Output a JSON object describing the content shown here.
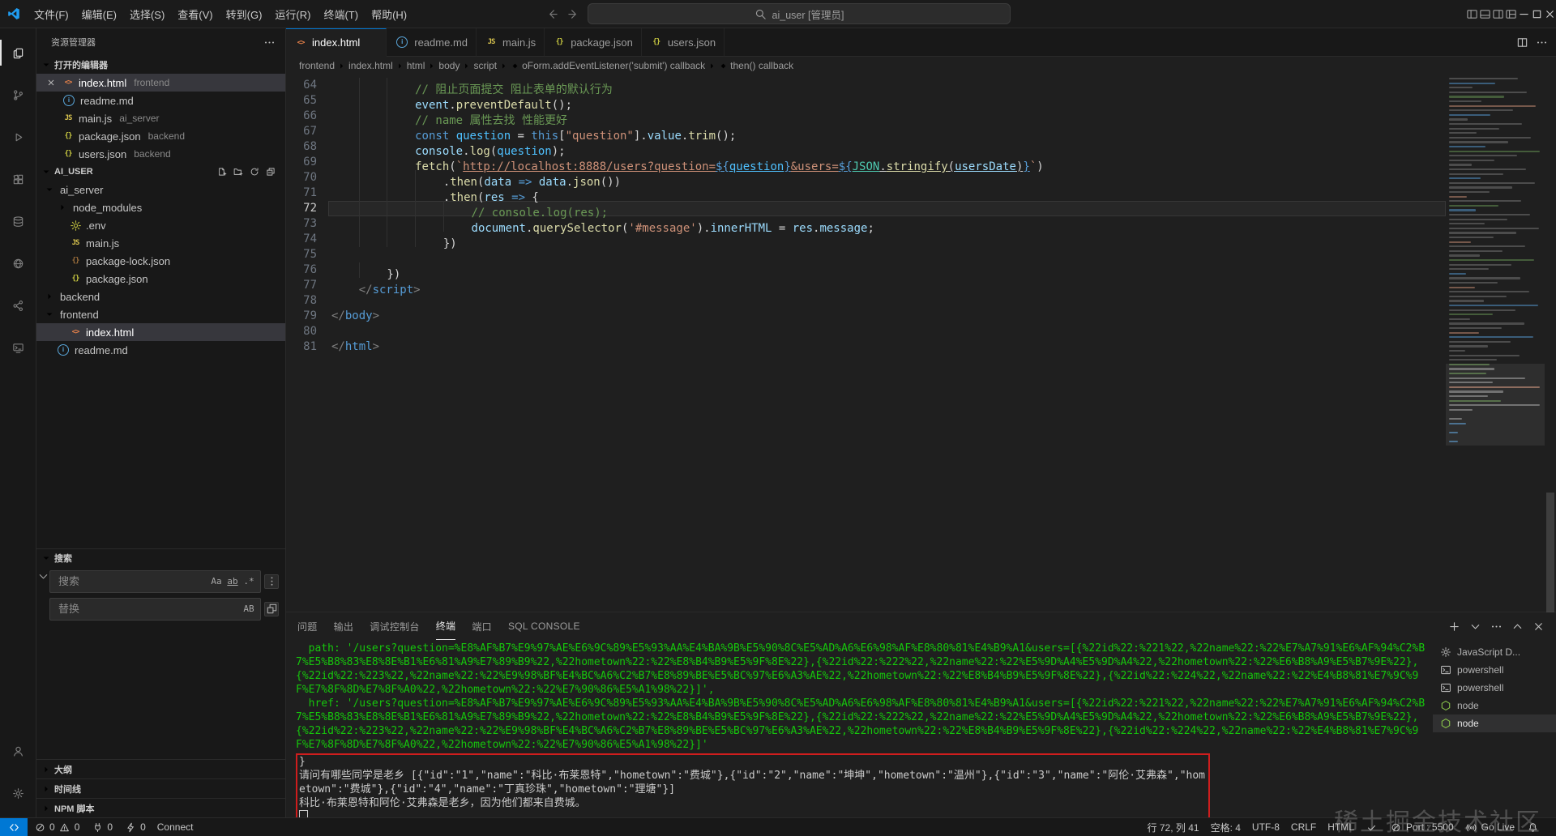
{
  "titlebar": {
    "menus": [
      "文件(F)",
      "编辑(E)",
      "选择(S)",
      "查看(V)",
      "转到(G)",
      "运行(R)",
      "终端(T)",
      "帮助(H)"
    ],
    "command_center": "ai_user [管理员]"
  },
  "activity_bar": {
    "top": [
      {
        "name": "explorer",
        "active": true
      },
      {
        "name": "source-control"
      },
      {
        "name": "run-and-debug"
      },
      {
        "name": "extensions"
      },
      {
        "name": "database"
      },
      {
        "name": "globe"
      },
      {
        "name": "live-share"
      },
      {
        "name": "remote-explorer"
      }
    ],
    "bottom": [
      {
        "name": "accounts"
      },
      {
        "name": "manage"
      }
    ]
  },
  "sidebar": {
    "title": "资源管理器",
    "open_editors": {
      "header": "打开的编辑器",
      "items": [
        {
          "icon": "html",
          "name": "index.html",
          "badge": "frontend",
          "selected": true,
          "close": true
        },
        {
          "icon": "info",
          "name": "readme.md",
          "badge": ""
        },
        {
          "icon": "js",
          "name": "main.js",
          "badge": "ai_server"
        },
        {
          "icon": "json",
          "name": "package.json",
          "badge": "backend"
        },
        {
          "icon": "json",
          "name": "users.json",
          "badge": "backend"
        }
      ]
    },
    "tree": {
      "header": "AI_USER",
      "items": [
        {
          "label": "ai_server",
          "folder": true,
          "expanded": true,
          "level": 0
        },
        {
          "label": "node_modules",
          "folder": true,
          "level": 1
        },
        {
          "label": ".env",
          "icon": "gear",
          "level": 1
        },
        {
          "label": "main.js",
          "icon": "js",
          "level": 1
        },
        {
          "label": "package-lock.json",
          "icon": "lock",
          "level": 1
        },
        {
          "label": "package.json",
          "icon": "json",
          "level": 1
        },
        {
          "label": "backend",
          "folder": true,
          "level": 0
        },
        {
          "label": "frontend",
          "folder": true,
          "expanded": true,
          "level": 0
        },
        {
          "label": "index.html",
          "icon": "html",
          "level": 1,
          "selected": true
        },
        {
          "label": "readme.md",
          "icon": "info",
          "level": 0
        }
      ]
    },
    "search": {
      "header": "搜索",
      "search_placeholder": "搜索",
      "replace_placeholder": "替换"
    },
    "bottom_sections": [
      "大纲",
      "时间线",
      "NPM 脚本"
    ]
  },
  "editor": {
    "tabs": [
      {
        "icon": "html",
        "label": "index.html",
        "active": true
      },
      {
        "icon": "info",
        "label": "readme.md"
      },
      {
        "icon": "js",
        "label": "main.js"
      },
      {
        "icon": "json",
        "label": "package.json"
      },
      {
        "icon": "json",
        "label": "users.json"
      }
    ],
    "breadcrumb": [
      {
        "label": "frontend"
      },
      {
        "label": "index.html"
      },
      {
        "label": "html"
      },
      {
        "label": "body"
      },
      {
        "label": "script"
      },
      {
        "label": "oForm.addEventListener('submit') callback",
        "sym": true
      },
      {
        "label": "then() callback",
        "sym": true
      }
    ],
    "code": {
      "current_line": 72,
      "lines": [
        {
          "n": 64,
          "i": 3,
          "tk": [
            [
              "c",
              "// 阻止页面提交 阻止表单的默认行为"
            ]
          ]
        },
        {
          "n": 65,
          "i": 3,
          "tk": [
            [
              "v",
              "event"
            ],
            [
              "p",
              "."
            ],
            [
              "f",
              "preventDefault"
            ],
            [
              "p",
              "();"
            ]
          ]
        },
        {
          "n": 66,
          "i": 3,
          "tk": [
            [
              "c",
              "// name 属性去找 性能更好"
            ]
          ]
        },
        {
          "n": 67,
          "i": 3,
          "tk": [
            [
              "k",
              "const "
            ],
            [
              "C",
              "question"
            ],
            [
              "p",
              " = "
            ],
            [
              "k",
              "this"
            ],
            [
              "p",
              "["
            ],
            [
              "s",
              "\"question\""
            ],
            [
              "p",
              "]."
            ],
            [
              "v",
              "value"
            ],
            [
              "p",
              "."
            ],
            [
              "f",
              "trim"
            ],
            [
              "p",
              "();"
            ]
          ]
        },
        {
          "n": 68,
          "i": 3,
          "tk": [
            [
              "v",
              "console"
            ],
            [
              "p",
              "."
            ],
            [
              "f",
              "log"
            ],
            [
              "p",
              "("
            ],
            [
              "C",
              "question"
            ],
            [
              "p",
              ");"
            ]
          ]
        },
        {
          "n": 69,
          "i": 3,
          "tk": [
            [
              "f",
              "fetch"
            ],
            [
              "p",
              "("
            ],
            [
              "s",
              "`"
            ],
            [
              "s",
              "http://localhost:8888/users?question=",
              1
            ],
            [
              "k",
              "${",
              1
            ],
            [
              "C",
              "question",
              1
            ],
            [
              "k",
              "}",
              1
            ],
            [
              "s",
              "&users=",
              1
            ],
            [
              "k",
              "${",
              1
            ],
            [
              "K",
              "JSON",
              1
            ],
            [
              "p",
              ".",
              1
            ],
            [
              "f",
              "stringify",
              1
            ],
            [
              "p",
              "(",
              1
            ],
            [
              "v",
              "usersDate",
              1
            ],
            [
              "p",
              ")",
              1
            ],
            [
              "k",
              "}",
              1
            ],
            [
              "s",
              "`"
            ],
            [
              "p",
              ")"
            ]
          ]
        },
        {
          "n": 70,
          "i": 4,
          "tk": [
            [
              "p",
              "."
            ],
            [
              "f",
              "then"
            ],
            [
              "p",
              "("
            ],
            [
              "v",
              "data"
            ],
            [
              "p",
              " "
            ],
            [
              "k",
              "=>"
            ],
            [
              "p",
              " "
            ],
            [
              "v",
              "data"
            ],
            [
              "p",
              "."
            ],
            [
              "f",
              "json"
            ],
            [
              "p",
              "())"
            ]
          ]
        },
        {
          "n": 71,
          "i": 4,
          "tk": [
            [
              "p",
              "."
            ],
            [
              "f",
              "then"
            ],
            [
              "p",
              "("
            ],
            [
              "v",
              "res"
            ],
            [
              "p",
              " "
            ],
            [
              "k",
              "=>"
            ],
            [
              "p",
              " {"
            ]
          ]
        },
        {
          "n": 72,
          "i": 5,
          "tk": [
            [
              "c",
              "// console.log(res);"
            ]
          ]
        },
        {
          "n": 73,
          "i": 5,
          "tk": [
            [
              "v",
              "document"
            ],
            [
              "p",
              "."
            ],
            [
              "f",
              "querySelector"
            ],
            [
              "p",
              "("
            ],
            [
              "s",
              "'#message'"
            ],
            [
              "p",
              ")."
            ],
            [
              "v",
              "innerHTML"
            ],
            [
              "p",
              " = "
            ],
            [
              "v",
              "res"
            ],
            [
              "p",
              "."
            ],
            [
              "v",
              "message"
            ],
            [
              "p",
              ";"
            ]
          ]
        },
        {
          "n": 74,
          "i": 4,
          "tk": [
            [
              "p",
              "})"
            ]
          ]
        },
        {
          "n": 75,
          "i": 0,
          "tk": []
        },
        {
          "n": 76,
          "i": 2,
          "tk": [
            [
              "p",
              "})"
            ]
          ]
        },
        {
          "n": 77,
          "i": 1,
          "tk": [
            [
              "t",
              "</"
            ],
            [
              "T",
              "script"
            ],
            [
              "t",
              ">"
            ]
          ]
        },
        {
          "n": 78,
          "i": 0,
          "tk": []
        },
        {
          "n": 79,
          "i": 0,
          "tk": [
            [
              "t",
              "</"
            ],
            [
              "T",
              "body"
            ],
            [
              "t",
              ">"
            ]
          ]
        },
        {
          "n": 80,
          "i": 0,
          "tk": []
        },
        {
          "n": 81,
          "i": 0,
          "tk": [
            [
              "t",
              "</"
            ],
            [
              "T",
              "html"
            ],
            [
              "t",
              ">"
            ]
          ]
        }
      ]
    }
  },
  "panel": {
    "tabs": [
      "问题",
      "输出",
      "调试控制台",
      "终端",
      "端口",
      "SQL CONSOLE"
    ],
    "active_tab": "终端",
    "terminal": {
      "green_lines": [
        "  path: '/users?question=%E8%AF%B7%E9%97%AE%E6%9C%89%E5%93%AA%E4%BA%9B%E5%90%8C%E5%AD%A6%E6%98%AF%E8%80%81%E4%B9%A1&users=[{%22id%22:%221%22,%22name%22:%22%E7%A7%91%E6%AF%94%C2%B7%E5%B8%83%E8%8E%B1%E6%81%A9%E7%89%B9%22,%22hometown%22:%22%E8%B4%B9%E5%9F%8E%22},{%22id%22:%222%22,%22name%22:%22%E5%9D%A4%E5%9D%A4%22,%22hometown%22:%22%E6%B8%A9%E5%B7%9E%22},{%22id%22:%223%22,%22name%22:%22%E9%98%BF%E4%BC%A6%C2%B7%E8%89%BE%E5%BC%97%E6%A3%AE%22,%22hometown%22:%22%E8%B4%B9%E5%9F%8E%22},{%22id%22:%224%22,%22name%22:%22%E4%B8%81%E7%9C%9F%E7%8F%8D%E7%8F%A0%22,%22hometown%22:%22%E7%90%86%E5%A1%98%22}]',",
        "  href: '/users?question=%E8%AF%B7%E9%97%AE%E6%9C%89%E5%93%AA%E4%BA%9B%E5%90%8C%E5%AD%A6%E6%98%AF%E8%80%81%E4%B9%A1&users=[{%22id%22:%221%22,%22name%22:%22%E7%A7%91%E6%AF%94%C2%B7%E5%B8%83%E8%8E%B1%E6%81%A9%E7%89%B9%22,%22hometown%22:%22%E8%B4%B9%E5%9F%8E%22},{%22id%22:%222%22,%22name%22:%22%E5%9D%A4%E5%9D%A4%22,%22hometown%22:%22%E6%B8%A9%E5%B7%9E%22},{%22id%22:%223%22,%22name%22:%22%E9%98%BF%E4%BC%A6%C2%B7%E8%89%BE%E5%BC%97%E6%A3%AE%22,%22hometown%22:%22%E8%B4%B9%E5%9F%8E%22},{%22id%22:%224%22,%22name%22:%22%E4%B8%81%E7%9C%9F%E7%8F%8D%E7%8F%A0%22,%22hometown%22:%22%E7%90%86%E5%A1%98%22}]'"
      ],
      "white_lines": [
        "}",
        "请问有哪些同学是老乡 [{\"id\":\"1\",\"name\":\"科比·布莱恩特\",\"hometown\":\"费城\"},{\"id\":\"2\",\"name\":\"坤坤\",\"hometown\":\"温州\"},{\"id\":\"3\",\"name\":\"阿伦·艾弗森\",\"hometown\":\"费城\"},{\"id\":\"4\",\"name\":\"丁真珍珠\",\"hometown\":\"理塘\"}]",
        "科比·布莱恩特和阿伦·艾弗森是老乡，因为他们都来自费城。"
      ]
    },
    "terminal_list": [
      {
        "icon": "gear",
        "label": "JavaScript D..."
      },
      {
        "icon": "term",
        "label": "powershell"
      },
      {
        "icon": "term",
        "label": "powershell"
      },
      {
        "icon": "node",
        "label": "node"
      },
      {
        "icon": "node",
        "label": "node",
        "selected": true
      }
    ]
  },
  "statusbar": {
    "left": {
      "errors": "0",
      "warnings": "0",
      "badge1": "0",
      "badge2": "0",
      "connect_label": "Connect"
    },
    "right": [
      {
        "name": "cursor-position",
        "text": "行 72, 列 41"
      },
      {
        "name": "indentation",
        "text": "空格: 4"
      },
      {
        "name": "encoding",
        "text": "UTF-8"
      },
      {
        "name": "eol",
        "text": "CRLF"
      },
      {
        "name": "language-mode",
        "text": "HTML"
      },
      {
        "name": "formatter",
        "icon": "check",
        "text": ""
      },
      {
        "name": "live-server-port",
        "icon": "cslash",
        "text": "Port : 5500"
      },
      {
        "name": "go-live",
        "icon": "cast",
        "text": "Go Live"
      },
      {
        "name": "notifications",
        "icon": "bell",
        "text": ""
      }
    ]
  },
  "watermark": "稀土掘金技术社区"
}
